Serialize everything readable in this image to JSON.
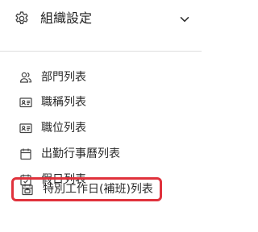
{
  "header": {
    "title": "組織設定",
    "icon": "gear-icon",
    "chevron_icon": "chevron-down-icon",
    "expanded": true
  },
  "menu": {
    "items": [
      {
        "label": "部門列表",
        "icon": "people-icon"
      },
      {
        "label": "職稱列表",
        "icon": "id-card-icon"
      },
      {
        "label": "職位列表",
        "icon": "id-card-icon"
      },
      {
        "label": "出勤行事曆列表",
        "icon": "calendar-icon"
      },
      {
        "label": "假日列表",
        "icon": "calendar-check-icon"
      },
      {
        "label": "特別工作日(補班)列表",
        "icon": "calendar-work-icon",
        "highlighted": true
      }
    ]
  },
  "colors": {
    "highlight_border": "#e0323c",
    "text": "#2b2b2b",
    "icon": "#444444",
    "divider": "#dddddd"
  }
}
